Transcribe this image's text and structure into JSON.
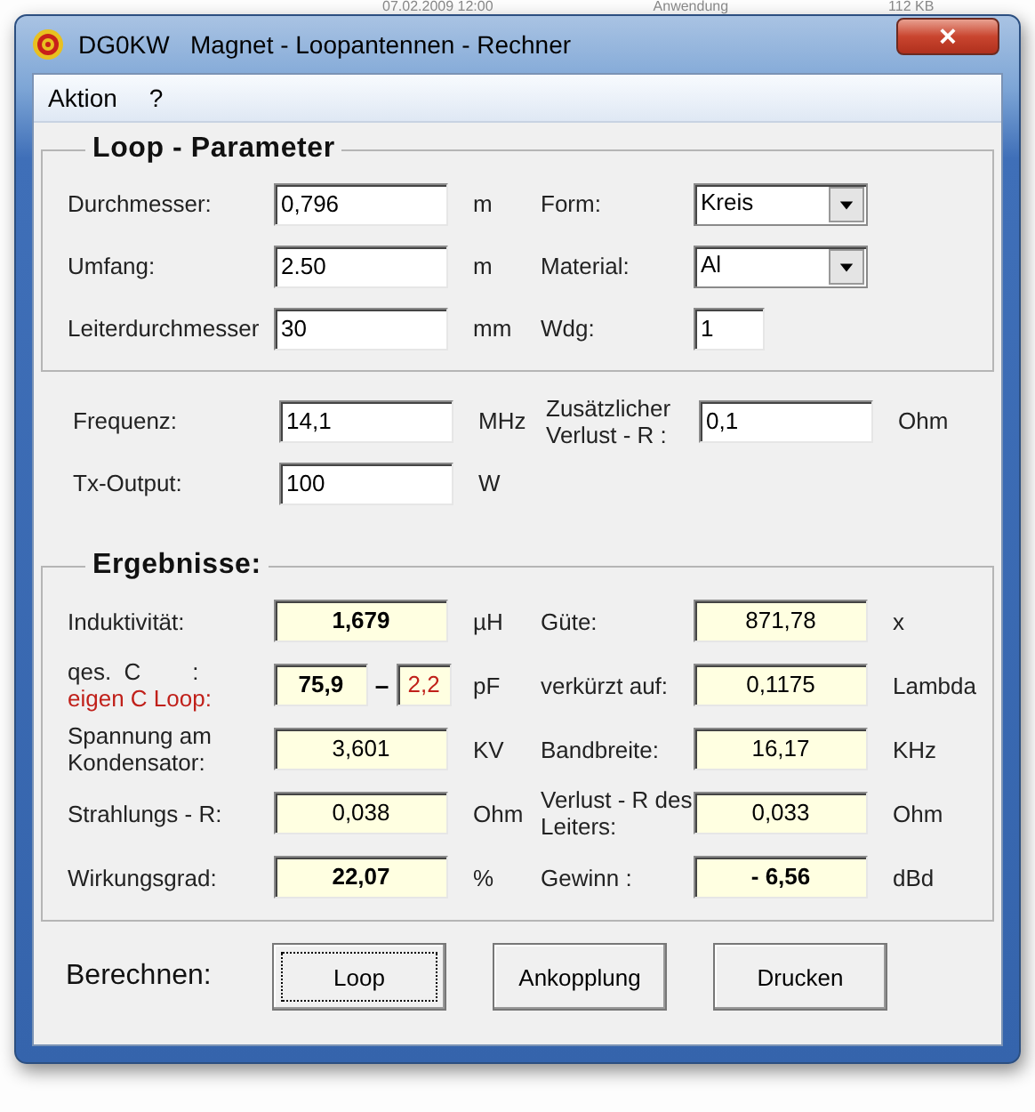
{
  "background_row": [
    "07.02.2009 12:00",
    "Anwendung",
    "112 KB"
  ],
  "window": {
    "title": "DG0KW   Magnet - Loopantennen - Rechner",
    "close": "×"
  },
  "menu": [
    {
      "label": "Aktion"
    },
    {
      "label": "?"
    }
  ],
  "loop_parameter": {
    "title": "Loop - Parameter",
    "rows": [
      {
        "left": {
          "label": "Durchmesser:",
          "value": "0,796",
          "unit": "m"
        },
        "right": {
          "kind": "dropdown",
          "label": "Form:",
          "value": "Kreis"
        }
      },
      {
        "left": {
          "label": "Umfang:",
          "value": "2.50",
          "unit": "m"
        },
        "right": {
          "kind": "dropdown",
          "label": "Material:",
          "value": "Al"
        }
      },
      {
        "left": {
          "label": "Leiterdurchmesser",
          "value": "30",
          "unit": "mm"
        },
        "right": {
          "kind": "small",
          "label": "Wdg:",
          "value": "1"
        }
      }
    ]
  },
  "operating": {
    "rows": [
      {
        "left": {
          "label": "Frequenz:",
          "value": "14,1",
          "unit": "MHz"
        },
        "right": {
          "kind": "input",
          "label": "Zusätzlicher Verlust - R :",
          "value": "0,1",
          "unit": "Ohm"
        }
      },
      {
        "left": {
          "label": "Tx-Output:",
          "value": "100",
          "unit": "W"
        }
      }
    ]
  },
  "results": {
    "title": "Ergebnisse:",
    "rows": [
      {
        "left": {
          "kind": "single",
          "label": "Induktivität:",
          "value": "1,679",
          "bold": true,
          "unit": "µH"
        },
        "right": {
          "label": "Güte:",
          "value": "871,78",
          "bold": false,
          "unit": "x"
        }
      },
      {
        "left": {
          "kind": "split",
          "label": "qes.  C        :",
          "label_2": "eigen C Loop:",
          "value": "75,9",
          "bold": true,
          "separator": "–",
          "value_2": "2,2",
          "unit": "pF"
        },
        "right": {
          "label": "verkürzt auf:",
          "value": "0,1175",
          "bold": false,
          "unit": "Lambda"
        }
      },
      {
        "left": {
          "kind": "single",
          "label": "Spannung am Kondensator:",
          "value": "3,601",
          "bold": false,
          "unit": "KV"
        },
        "right": {
          "label": "Bandbreite:",
          "value": "16,17",
          "bold": false,
          "unit": "KHz"
        }
      },
      {
        "left": {
          "kind": "single",
          "label": "Strahlungs - R:",
          "value": "0,038",
          "bold": false,
          "unit": "Ohm"
        },
        "right": {
          "label": "Verlust - R des Leiters:",
          "value": "0,033",
          "bold": false,
          "unit": "Ohm"
        }
      },
      {
        "left": {
          "kind": "single",
          "label": "Wirkungsgrad:",
          "value": "22,07",
          "bold": true,
          "unit": "%"
        },
        "right": {
          "label": "Gewinn :",
          "value": "- 6,56",
          "bold": true,
          "unit": "dBd"
        }
      }
    ]
  },
  "footer": {
    "label": "Berechnen:",
    "buttons": [
      {
        "label": "Loop",
        "focused": true
      },
      {
        "label": "Ankopplung",
        "focused": false
      },
      {
        "label": "Drucken",
        "focused": false
      }
    ]
  }
}
